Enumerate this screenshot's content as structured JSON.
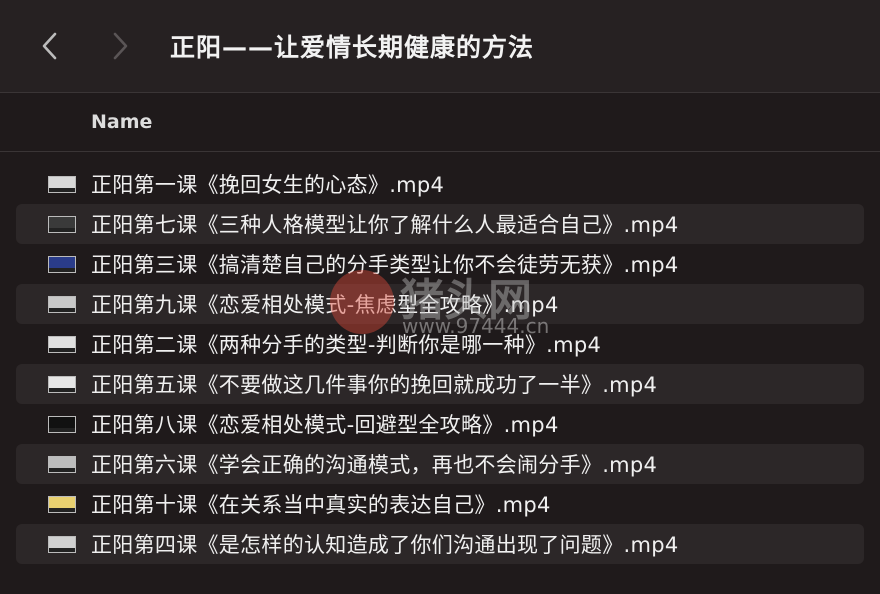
{
  "window": {
    "title": "正阳——让爱情长期健康的方法"
  },
  "header": {
    "name_label": "Name"
  },
  "files": [
    {
      "name": "正阳第一课《挽回女生的心态》.mp4",
      "thumb_color": "#d8d8d8"
    },
    {
      "name": "正阳第七课《三种人格模型让你了解什么人最适合自己》.mp4",
      "thumb_color": "#3a3a3a"
    },
    {
      "name": "正阳第三课《搞清楚自己的分手类型让你不会徒劳无获》.mp4",
      "thumb_color": "#2a3c8a"
    },
    {
      "name": "正阳第九课《恋爱相处模式-焦虑型全攻略》.mp4",
      "thumb_color": "#c8c8c8"
    },
    {
      "name": "正阳第二课《两种分手的类型-判断你是哪一种》.mp4",
      "thumb_color": "#e0e0e0"
    },
    {
      "name": "正阳第五课《不要做这几件事你的挽回就成功了一半》.mp4",
      "thumb_color": "#e6e6e6"
    },
    {
      "name": "正阳第八课《恋爱相处模式-回避型全攻略》.mp4",
      "thumb_color": "#111111"
    },
    {
      "name": "正阳第六课《学会正确的沟通模式，再也不会闹分手》.mp4",
      "thumb_color": "#bdbdbd"
    },
    {
      "name": "正阳第十课《在关系当中真实的表达自己》.mp4",
      "thumb_color": "#e8d070"
    },
    {
      "name": "正阳第四课《是怎样的认知造成了你们沟通出现了问题》.mp4",
      "thumb_color": "#d0d0d0"
    }
  ],
  "watermark": {
    "text": "猪头网",
    "url": "www.97444.cn"
  }
}
